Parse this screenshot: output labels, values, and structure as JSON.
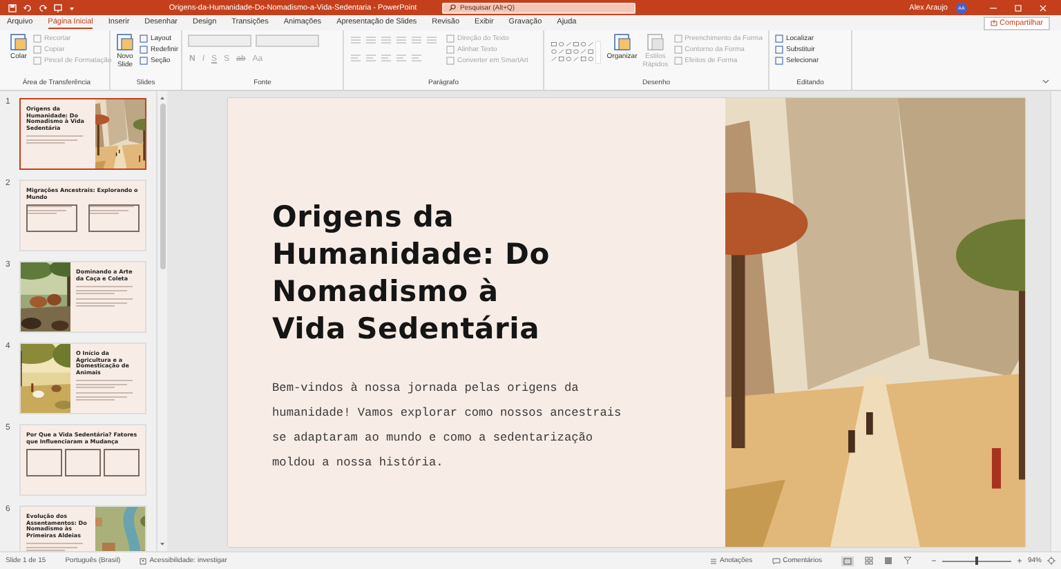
{
  "titlebar": {
    "document_title": "Origens-da-Humanidade-Do-Nomadismo-a-Vida-Sedentaria - PowerPoint",
    "search_placeholder": "Pesquisar (Alt+Q)",
    "user_name": "Alex Araujo",
    "user_initials": "AA"
  },
  "menu_tabs": [
    {
      "label": "Arquivo",
      "selected": false
    },
    {
      "label": "Página Inicial",
      "selected": true
    },
    {
      "label": "Inserir",
      "selected": false
    },
    {
      "label": "Desenhar",
      "selected": false
    },
    {
      "label": "Design",
      "selected": false
    },
    {
      "label": "Transições",
      "selected": false
    },
    {
      "label": "Animações",
      "selected": false
    },
    {
      "label": "Apresentação de Slides",
      "selected": false
    },
    {
      "label": "Revisão",
      "selected": false
    },
    {
      "label": "Exibir",
      "selected": false
    },
    {
      "label": "Gravação",
      "selected": false
    },
    {
      "label": "Ajuda",
      "selected": false
    }
  ],
  "share_button": "Compartilhar",
  "ribbon_groups": [
    {
      "label": "Área de Transferência",
      "items": [
        {
          "kind": "large",
          "label": "Colar",
          "disabled": false
        },
        {
          "kind": "small",
          "label": "Recortar",
          "disabled": true
        },
        {
          "kind": "small",
          "label": "Copiar",
          "disabled": true
        },
        {
          "kind": "small",
          "label": "Pincel de Formatação",
          "disabled": true
        }
      ]
    },
    {
      "label": "Slides",
      "items": [
        {
          "kind": "large",
          "label": "Novo Slide",
          "disabled": false
        },
        {
          "kind": "small",
          "label": "Layout",
          "disabled": false
        },
        {
          "kind": "small",
          "label": "Redefinir",
          "disabled": false
        },
        {
          "kind": "small",
          "label": "Seção",
          "disabled": false
        }
      ]
    },
    {
      "label": "Fonte",
      "items": [
        {
          "kind": "field",
          "disabled": true
        },
        {
          "kind": "field",
          "disabled": true
        },
        {
          "kind": "glyph",
          "label": "N",
          "disabled": true
        },
        {
          "kind": "glyph",
          "label": "I",
          "disabled": true
        },
        {
          "kind": "glyph",
          "label": "S",
          "disabled": true
        },
        {
          "kind": "glyph",
          "label": "S",
          "disabled": true
        },
        {
          "kind": "glyph",
          "label": "ab",
          "disabled": true
        },
        {
          "kind": "glyph",
          "label": "Aa",
          "disabled": true
        }
      ]
    },
    {
      "label": "Parágrafo",
      "items": [
        {
          "kind": "paragraph-tools",
          "disabled": true
        },
        {
          "kind": "small",
          "label": "Direção do Texto",
          "disabled": true
        },
        {
          "kind": "small",
          "label": "Alinhar Texto",
          "disabled": true
        },
        {
          "kind": "small",
          "label": "Converter em SmartArt",
          "disabled": true
        }
      ]
    },
    {
      "label": "Desenho",
      "items": [
        {
          "kind": "shape-gallery",
          "disabled": false
        },
        {
          "kind": "large",
          "label": "Organizar",
          "disabled": false
        },
        {
          "kind": "large",
          "label": "Estilos Rápidos",
          "disabled": true
        },
        {
          "kind": "small",
          "label": "Preenchimento da Forma",
          "disabled": true
        },
        {
          "kind": "small",
          "label": "Contorno da Forma",
          "disabled": true
        },
        {
          "kind": "small",
          "label": "Efeitos de Forma",
          "disabled": true
        }
      ]
    },
    {
      "label": "Editando",
      "items": [
        {
          "kind": "small",
          "label": "Localizar",
          "disabled": false
        },
        {
          "kind": "small",
          "label": "Substituir",
          "disabled": false
        },
        {
          "kind": "small",
          "label": "Selecionar",
          "disabled": false
        }
      ]
    }
  ],
  "thumbnails": [
    {
      "number": "1",
      "title": "Origens da Humanidade: Do Nomadismo à Vida Sedentária",
      "kind": "image-right",
      "selected": true
    },
    {
      "number": "2",
      "title": "Migrações Ancestrais: Explorando o Mundo",
      "kind": "text-columns",
      "selected": false
    },
    {
      "number": "3",
      "title": "Dominando a Arte da Caça e Coleta",
      "kind": "image-left",
      "selected": false
    },
    {
      "number": "4",
      "title": "O Início da Agricultura e a Domesticação de Animais",
      "kind": "image-left",
      "selected": false
    },
    {
      "number": "5",
      "title": "Por Que a Vida Sedentária? Fatores que Influenciaram a Mudança",
      "kind": "boxes",
      "selected": false
    },
    {
      "number": "6",
      "title": "Evolução dos Assentamentos: Do Nomadismo às Primeiras Aldeias",
      "kind": "image-right",
      "selected": false
    }
  ],
  "slide": {
    "title": "Origens da Humanidade: Do Nomadismo à Vida Sedentária",
    "body": "Bem-vindos à nossa jornada pelas origens da humanidade! Vamos explorar como nossos ancestrais se adaptaram ao mundo e como a sedentarização moldou a nossa história."
  },
  "status_bar": {
    "slide_counter": "Slide 1 de 15",
    "language": "Português (Brasil)",
    "accessibility": "Acessibilidade: investigar",
    "notes": "Anotações",
    "comments": "Comentários",
    "zoom": "94%",
    "zoom_slider": {
      "level": 0.5
    }
  }
}
